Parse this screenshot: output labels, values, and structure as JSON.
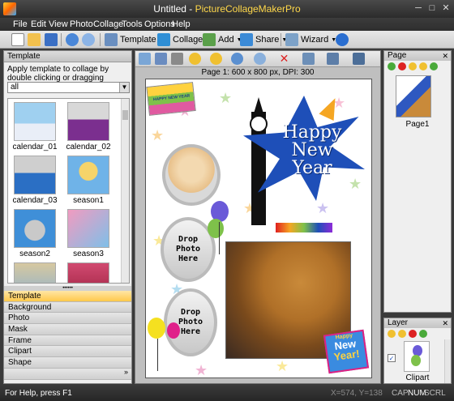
{
  "window": {
    "doc_title": "Untitled",
    "separator": " - ",
    "app_name": "PictureCollageMakerPro",
    "minimize": "─",
    "maximize": "□",
    "close": "✕"
  },
  "menu": [
    "File",
    "Edit",
    "View",
    "Photo",
    "Collage",
    "Tools",
    "Options",
    "Help"
  ],
  "toolbar": {
    "template_label": "Template",
    "collage_label": "Collage",
    "add_label": "Add",
    "share_label": "Share",
    "wizard_label": "Wizard"
  },
  "template_panel": {
    "header": "Template",
    "hint": "Apply template to collage by double clicking or dragging",
    "filter_value": "all",
    "templates": [
      "calendar_01",
      "calendar_02",
      "calendar_03",
      "season1",
      "season2",
      "season3"
    ]
  },
  "categories": [
    "Template",
    "Background",
    "Photo",
    "Mask",
    "Frame",
    "Clipart",
    "Shape"
  ],
  "more_glyph": "»",
  "canvas": {
    "caption": "Page 1: 600 x 800 px, DPI: 300",
    "slot_text": "Drop Photo Here",
    "headline_1": "Happy",
    "headline_2": "New",
    "headline_3": "Year",
    "banner_text": "HAPPY NEW YEAR",
    "sticker_small": "Happy",
    "sticker_big_1": "New",
    "sticker_big_2": "Year!"
  },
  "page_panel": {
    "header": "Page",
    "close": "✕",
    "item_label": "Page1"
  },
  "layer_panel": {
    "header": "Layer",
    "close": "✕",
    "item_label": "Clipart",
    "checkbox": "✓"
  },
  "status": {
    "help": "For Help, press F1",
    "coords": "X=574, Y=138",
    "cap": "CAP",
    "num": "NUM",
    "scrl": "SCRL"
  },
  "colors": {
    "titlebar": "#2b2b2b",
    "accent": "#ffc84a",
    "app_name": "#ffd84a"
  }
}
